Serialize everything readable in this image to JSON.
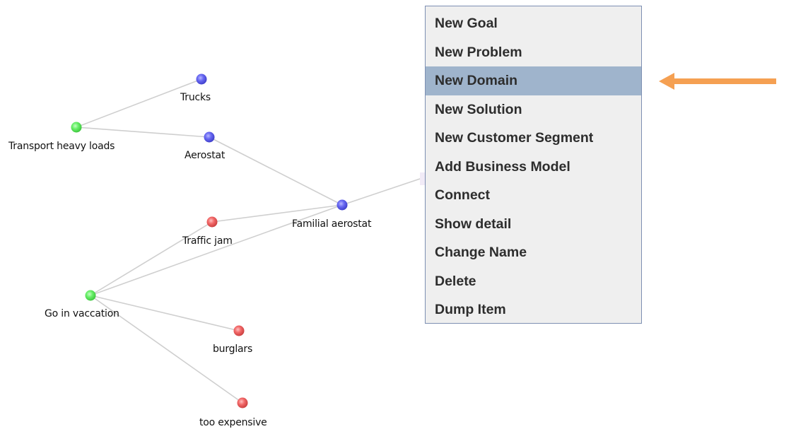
{
  "graph": {
    "nodes": [
      {
        "id": "trucks",
        "label": "Trucks",
        "color": "#6868f2"
      },
      {
        "id": "transport",
        "label": "Transport heavy loads",
        "color": "#68ef68"
      },
      {
        "id": "aerostat",
        "label": "Aerostat",
        "color": "#6868f2"
      },
      {
        "id": "familial",
        "label": "Familial aerostat",
        "color": "#6868f2"
      },
      {
        "id": "traffic",
        "label": "Traffic jam",
        "color": "#f26868"
      },
      {
        "id": "vacation",
        "label": "Go in vaccation",
        "color": "#68ef68"
      },
      {
        "id": "burglars",
        "label": "burglars",
        "color": "#f26868"
      },
      {
        "id": "expensive",
        "label": "too expensive",
        "color": "#f26868"
      }
    ],
    "edges": [
      [
        "transport",
        "trucks"
      ],
      [
        "transport",
        "aerostat"
      ],
      [
        "aerostat",
        "familial"
      ],
      [
        "traffic",
        "familial"
      ],
      [
        "vacation",
        "familial"
      ],
      [
        "vacation",
        "traffic"
      ],
      [
        "vacation",
        "burglars"
      ],
      [
        "vacation",
        "expensive"
      ],
      [
        "familial",
        "hidden"
      ]
    ],
    "edge_color": "#cfcfcf"
  },
  "context_menu": {
    "items": [
      {
        "label": "New Goal"
      },
      {
        "label": "New Problem"
      },
      {
        "label": "New Domain",
        "selected": true
      },
      {
        "label": "New Solution"
      },
      {
        "label": "New Customer Segment"
      },
      {
        "label": "Add Business Model"
      },
      {
        "label": "Connect"
      },
      {
        "label": "Show detail"
      },
      {
        "label": "Change Name"
      },
      {
        "label": "Delete"
      },
      {
        "label": "Dump Item"
      }
    ],
    "highlight_color": "#9fb4cc"
  },
  "annotation": {
    "arrow_color": "#f5a052"
  }
}
